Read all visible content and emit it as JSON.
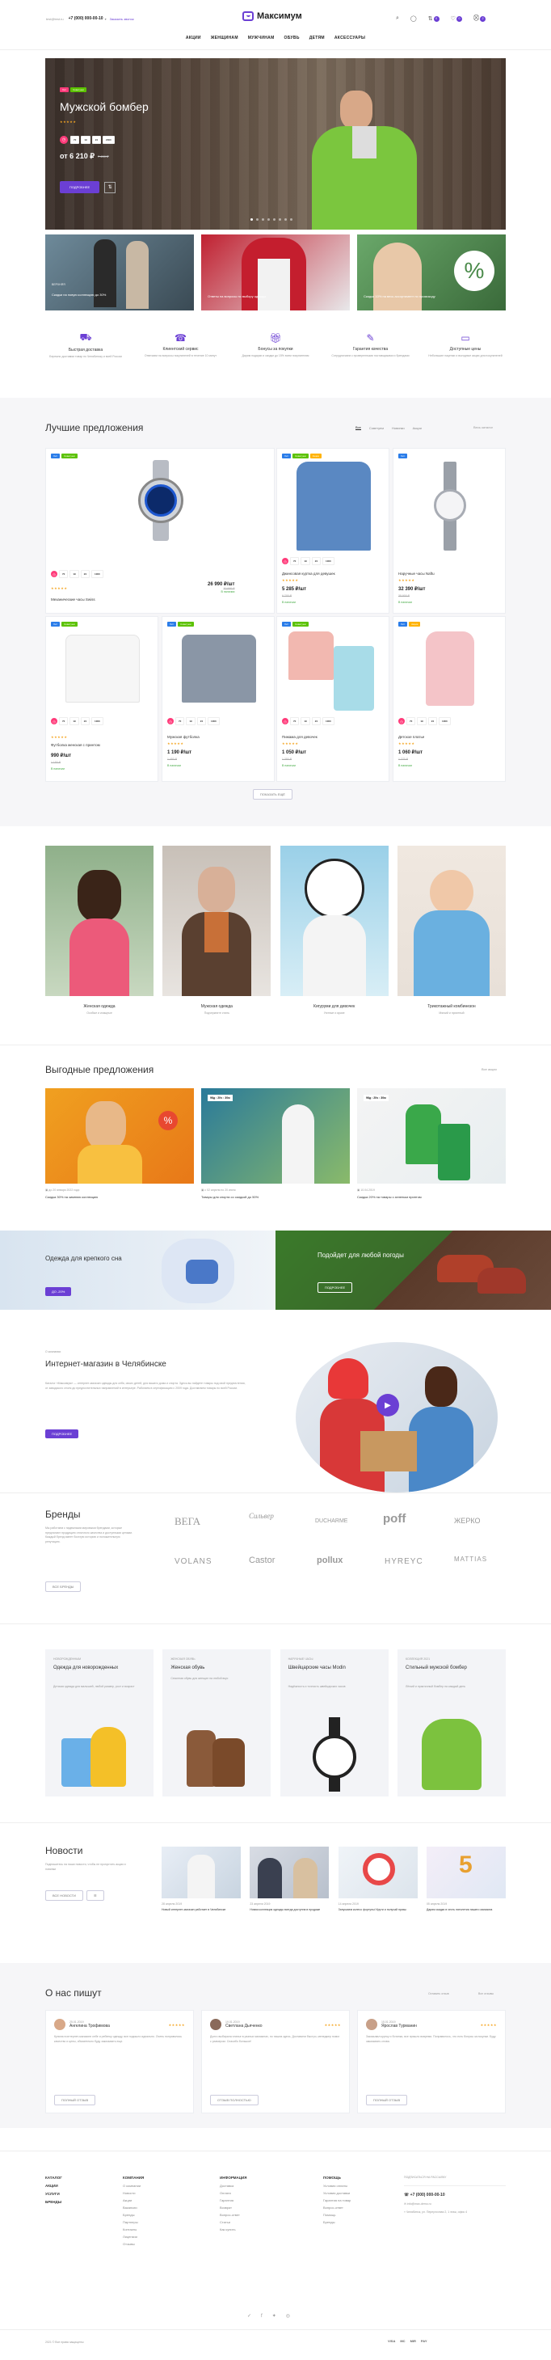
{
  "header": {
    "email": "test@test.ru",
    "phone": "+7 (000) 000-00-10",
    "callback": "Заказать звонок",
    "logo": "Максимум",
    "icons": [
      "search-icon",
      "user-icon",
      "compare-icon",
      "heart-icon",
      "cart-icon"
    ],
    "counts": [
      "0",
      "0",
      "2"
    ],
    "nav": [
      "АКЦИИ",
      "ЖЕНЩИНАМ",
      "МУЖЧИНАМ",
      "ОБУВЬ",
      "ДЕТЯМ",
      "АКСЕССУАРЫ"
    ]
  },
  "hero": {
    "badges": [
      "Хит",
      "Советуем"
    ],
    "title": "Мужской бомбер",
    "timer": [
      "70",
      "19",
      "24",
      "2000"
    ],
    "price": "от 6 210 ₽",
    "old_price": "7 450 ₽",
    "button": "ПОДРОБНЕЕ",
    "colors": {
      "accent": "#6b3fd4",
      "hit": "#ff3b7a",
      "advise": "#5cc200"
    }
  },
  "promos": [
    {
      "label": "ВЕРХНЯЯ",
      "text": "Скидки на новую коллекцию до 30%"
    },
    {
      "label": "",
      "text": "Ответы на вопросы по выбору одежды"
    },
    {
      "label": "",
      "text": "Скидка 10% на весь ассортимент по промокоду"
    }
  ],
  "features": [
    {
      "icon": "delivery-icon",
      "title": "Быстрая доставка",
      "text": "Бережно доставим товар по Челябинску и всей России"
    },
    {
      "icon": "service-icon",
      "title": "Клиентский сервис",
      "text": "Отвечаем на вопросы покупателей в течение 10 минут"
    },
    {
      "icon": "gift-icon",
      "title": "Бонусы за покупки",
      "text": "Дарим подарки и скидки до 15% всем покупателям"
    },
    {
      "icon": "quality-icon",
      "title": "Гарантия качества",
      "text": "Сотрудничаем с проверенными поставщиками и брендами"
    },
    {
      "icon": "price-icon",
      "title": "Доступные цены",
      "text": "Небольшие наценки и выгодные акции для покупателей"
    }
  ],
  "best": {
    "title": "Лучшие предложения",
    "tabs": [
      "Все",
      "Советуем",
      "Новинки",
      "Акции"
    ],
    "all_link": "Весь каталог",
    "more_button": "ПОКАЗАТЬ ЕЩЁ",
    "products": [
      {
        "name": "Механические часы Swiss",
        "price": "26 990 ₽/шт",
        "old": "30 990 ₽",
        "stock": "В наличии",
        "badges": [
          "Хит",
          "Советуем"
        ],
        "timer": [
          "70",
          "19",
          "24",
          "1000"
        ],
        "image": "watch-blue"
      },
      {
        "name": "Джинсовая куртка для девушек",
        "price": "5 285 ₽/шт",
        "old": "6 700 ₽",
        "stock": "В наличии",
        "badges": [
          "Хит",
          "Советуем",
          "Акция"
        ],
        "timer": [
          "70",
          "19",
          "24",
          "1000"
        ],
        "image": "denim-jacket"
      },
      {
        "name": "Наручные часы Naftu",
        "price": "32 390 ₽/шт",
        "old": "35 900 ₽",
        "stock": "В наличии",
        "badges": [
          "Хит"
        ],
        "timer": [],
        "image": "watch-silver"
      },
      {
        "name": "Футболка женская с принтом",
        "price": "990 ₽/шт",
        "old": "1 150 ₽",
        "stock": "В наличии",
        "badges": [
          "Хит",
          "Советуем"
        ],
        "timer": [
          "70",
          "19",
          "24",
          "1000"
        ],
        "image": "tshirt-white"
      },
      {
        "name": "Мужская футболка",
        "price": "1 190 ₽/шт",
        "old": "1 450 ₽",
        "stock": "В наличии",
        "badges": [
          "Хит",
          "Советуем"
        ],
        "timer": [
          "70",
          "19",
          "24",
          "1000"
        ],
        "image": "tshirt-grey"
      },
      {
        "name": "Пижама для девочек",
        "price": "1 050 ₽/шт",
        "old": "1 350 ₽",
        "stock": "В наличии",
        "badges": [
          "Хит",
          "Советуем"
        ],
        "timer": [
          "70",
          "19",
          "24",
          "1000"
        ],
        "image": "pajama"
      },
      {
        "name": "Детское платье",
        "price": "1 060 ₽/шт",
        "old": "1 270 ₽",
        "stock": "В наличии",
        "badges": [
          "Хит",
          "Акция"
        ],
        "timer": [
          "70",
          "19",
          "24",
          "1000"
        ],
        "image": "dress"
      }
    ]
  },
  "categories": [
    {
      "title": "Женская одежда",
      "sub": "Особые и изящные"
    },
    {
      "title": "Мужская одежда",
      "sub": "Подчеркните стиль"
    },
    {
      "title": "Кигуруми для девочек",
      "sub": "Уютные и яркие"
    },
    {
      "title": "Трикотажный комбинезон",
      "sub": "Мягкий и приятный"
    }
  ],
  "deals": {
    "title": "Выгодные предложения",
    "all_link": "Все акции",
    "items": [
      {
        "date": "до 20 января 2022 года",
        "text": "Скидка 30% на зимнюю коллекцию",
        "timer": ""
      },
      {
        "date": "с 02 апреля по 20 июня",
        "text": "Товары для спорта со скидкой до 50%",
        "timer": "96д : 20ч : 30м"
      },
      {
        "date": "10.04.2019",
        "text": "Скидка 20% на товары с зеленым принтом",
        "timer": "96д : 20ч : 30м"
      }
    ]
  },
  "banners": [
    {
      "title": "Одежда для крепкого сна",
      "button": "ДО -20%"
    },
    {
      "title": "Подойдет для любой погоды",
      "button": "ПОДРОБНЕЕ"
    }
  ],
  "about": {
    "label": "О компании",
    "title": "Интернет-магазин в Челябинске",
    "text": "Каталог «Максимум» — интернет-магазин одежды для себя, своих детей, для вашего дома и спорта. Здесь вы найдете товары под свой предпочтения, от заводского стиля до предпочтительных направлений в интерьере. Работаем в сертификацию с 2009 года. Доставляем товары по всей России.",
    "button": "ПОДРОБНЕЕ"
  },
  "brands": {
    "title": "Бренды",
    "text": "Мы работаем с надежными мировыми брендами, которые предлагают продукцию отличного качества и доступными ценами. Каждый бренд имеет богатую историю и положительную репутацию.",
    "button": "ВСЕ БРЕНДЫ",
    "names": [
      "ВЕГА",
      "Сильвер",
      "DUCHARME",
      "poff",
      "ЖЕРКО",
      "VOLANS",
      "Castor",
      "pollux",
      "HYREYC",
      "MATTIAS"
    ]
  },
  "collections": [
    {
      "label": "НОВОРОЖДЕННЫМ",
      "title": "Одежда для новорожденных",
      "text": "Детская одежда для малышей, любой размер, рост и возраст"
    },
    {
      "label": "ЖЕНСКАЯ ОБУВЬ",
      "title": "Женская обувь",
      "text": "Сезонная обувь для женщин на любой вкус"
    },
    {
      "label": "НАРУЧНЫЕ ЧАСЫ",
      "title": "Швейцарские часы Modin",
      "text": "Надёжность и точность швейцарских часов"
    },
    {
      "label": "КОЛЛЕКЦИЯ 2021",
      "title": "Стильный мужской бомбер",
      "text": "Лёгкий и практичный бомбер на каждый день"
    }
  ],
  "news": {
    "title": "Новости",
    "text": "Подпишитесь на наши новости, чтобы не пропустить акции и новинки",
    "button": "ВСЕ НОВОСТИ",
    "items": [
      {
        "date": "28 апреля 2019",
        "text": "Новый интернет-магазин работает в Челябинске"
      },
      {
        "date": "23 апреля 2019",
        "text": "Новая коллекция одежды всегда доступна в продаже"
      },
      {
        "date": "14 апреля 2019",
        "text": "Запускаем колесо фортуны! Крути и получай призы"
      },
      {
        "date": "05 апреля 2019",
        "text": "Дарим скидки в честь пятилетия нашего магазина"
      }
    ]
  },
  "reviews": {
    "title": "О нас пишут",
    "all_link": "Все отзывы",
    "write_link": "Оставить отзыв",
    "items": [
      {
        "date": "25.01.2019",
        "name": "Ангелина Трофимова",
        "text": "Купила в интернет-магазине себе и ребенку одежду, все подошло идеально. Очень понравилось качество и цены, обязательно буду заказывать еще.",
        "button": "ПОЛНЫЙ ОТЗЫВ"
      },
      {
        "date": "19.01.2019",
        "name": "Светлана Дьяченко",
        "text": "Долго выбирала платье в разных магазинах, но нашла здесь. Доставили быстро, менеджер помог с размером. Спасибо большое!",
        "button": "ОТЗЫВ ПОЛНОСТЬЮ"
      },
      {
        "date": "15.01.2019",
        "name": "Ярослав Турманин",
        "text": "Заказывал куртку и ботинки, все пришло вовремя. Понравилось, что есть бонусы за покупки. Буду заказывать снова.",
        "button": "ПОЛНЫЙ ОТЗЫВ"
      }
    ]
  },
  "footer": {
    "col1": [
      "КАТАЛОГ",
      "АКЦИИ",
      "УСЛУГИ",
      "БРЕНДЫ"
    ],
    "col2_title": "КОМПАНИЯ",
    "col2": [
      "О компании",
      "Новости",
      "Акции",
      "Вакансии",
      "Бренды",
      "Партнеры",
      "Контакты",
      "Лицензии",
      "Отзывы"
    ],
    "col3_title": "ИНФОРМАЦИЯ",
    "col3": [
      "Доставка",
      "Оплата",
      "Гарантия",
      "Возврат",
      "Вопрос-ответ",
      "Статьи",
      "Как купить"
    ],
    "col4_title": "ПОМОЩЬ",
    "col4": [
      "Условия оплаты",
      "Условия доставки",
      "Гарантия на товар",
      "Вопрос-ответ",
      "Помощь",
      "Бренды"
    ],
    "subscribe": "ПОДПИСАТЬСЯ НА РАССЫЛКУ",
    "phone": "+7 (000) 000-00-10",
    "email": "info@max-demo.ru",
    "address": "Челябинск, ул. Переулочная 2, 1 этаж, офис 4",
    "copyright": "2021 © Все права защищены",
    "payments": [
      "VISA",
      "MC",
      "MIR",
      "PAY"
    ]
  }
}
